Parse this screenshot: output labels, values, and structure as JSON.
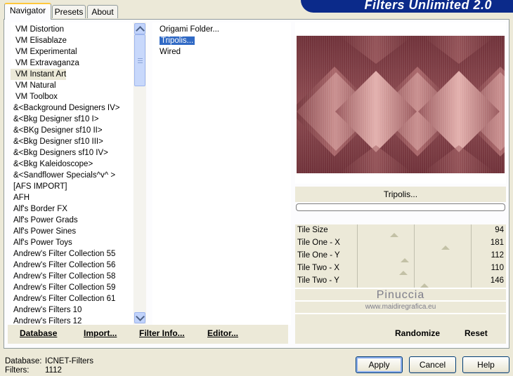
{
  "tabs": [
    "Navigator",
    "Presets",
    "About"
  ],
  "banner_title": "Filters Unlimited 2.0",
  "categories": [
    "VM Distortion",
    "VM Elisablaze",
    "VM Experimental",
    "VM Extravaganza",
    "VM Instant Art",
    "VM Natural",
    "VM Toolbox",
    "&<Background Designers IV>",
    "&<Bkg Designer sf10 I>",
    "&<BKg Designer sf10 II>",
    "&<Bkg Designer sf10 III>",
    "&<Bkg Designers sf10 IV>",
    "&<Bkg Kaleidoscope>",
    "&<Sandflower Specials^v^ >",
    "[AFS IMPORT]",
    "AFH",
    "Alf's Border FX",
    "Alf's Power Grads",
    "Alf's Power Sines",
    "Alf's Power Toys",
    "Andrew's Filter Collection 55",
    "Andrew's Filter Collection 56",
    "Andrew's Filter Collection 58",
    "Andrew's Filter Collection 59",
    "Andrew's Filter Collection 61",
    "Andrew's Filters 10",
    "Andrew's Filters 12"
  ],
  "selected_category_index": 4,
  "filters": [
    "Origami Folder...",
    "Tripolis...",
    "Wired"
  ],
  "selected_filter_index": 1,
  "left_buttons": {
    "database": "Database",
    "import": "Import...",
    "filter_info": "Filter Info...",
    "editor": "Editor..."
  },
  "filter_name": "Tripolis...",
  "params": [
    {
      "label": "Tile Size",
      "value": "94",
      "level": 0.37
    },
    {
      "label": "Tile One - X",
      "value": "181",
      "level": 0.71
    },
    {
      "label": "Tile One - Y",
      "value": "112",
      "level": 0.44
    },
    {
      "label": "Tile Two - X",
      "value": "110",
      "level": 0.43
    },
    {
      "label": "Tile Two - Y",
      "value": "146",
      "level": 0.57
    }
  ],
  "watermark": {
    "line1": "Pinuccia",
    "line2": "www.maidiregrafica.eu"
  },
  "right_buttons": {
    "randomize": "Randomize",
    "reset": "Reset"
  },
  "status": {
    "database_label": "Database:",
    "database_value": "ICNET-Filters",
    "filters_label": "Filters:",
    "filters_value": "1112"
  },
  "dialog_buttons": {
    "apply": "Apply",
    "cancel": "Cancel",
    "help": "Help"
  },
  "colors": {
    "selection": "#316ac5",
    "banner": "#0b2a8a",
    "preview_dark": "#7a3a40",
    "preview_light": "#d29a98"
  }
}
